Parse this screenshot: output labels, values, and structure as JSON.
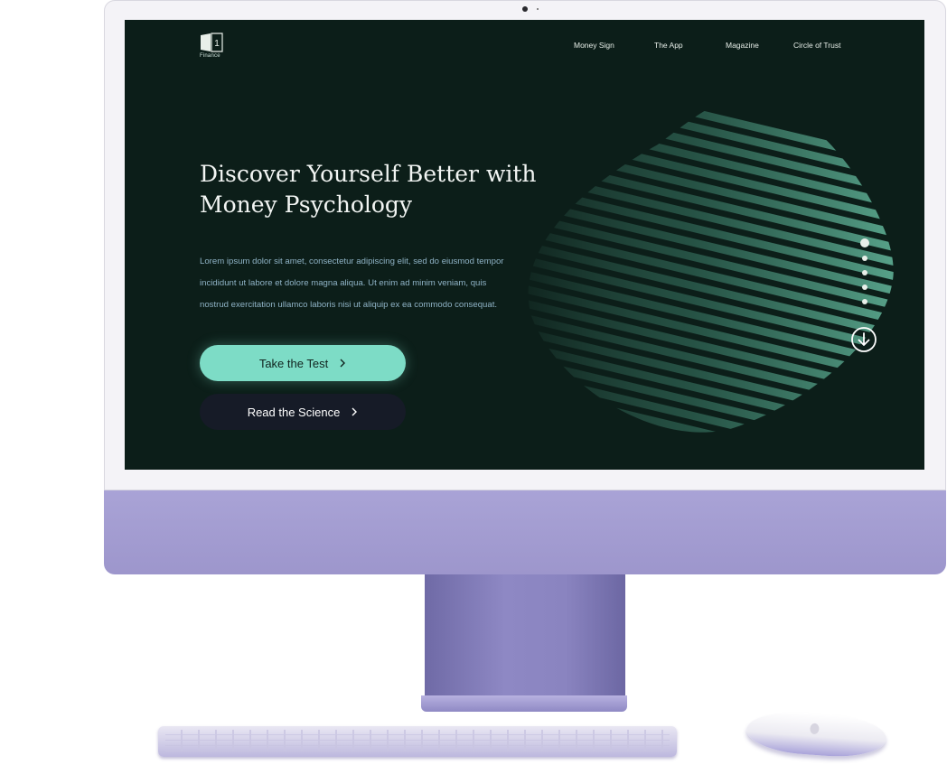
{
  "brand": {
    "name": "Finance",
    "logo_number": "1"
  },
  "nav": {
    "items": [
      {
        "label": "Money Sign"
      },
      {
        "label": "The App"
      },
      {
        "label": "Magazine"
      },
      {
        "label": "Circle of Trust"
      }
    ]
  },
  "hero": {
    "headline_lines": [
      "Discover Yourself  Better with",
      "Money Psychology"
    ],
    "body_lines": [
      "Lorem ipsum dolor sit amet, consectetur adipiscing elit, sed do eiusmod tempor",
      "incididunt ut labore et dolore magna aliqua. Ut enim ad minim veniam, quis",
      "nostrud exercitation ullamco laboris nisi ut aliquip ex ea commodo consequat."
    ],
    "primary_button": {
      "label": "Take the Test",
      "icon": "chevron-right-icon"
    },
    "secondary_button": {
      "label": "Read the Science",
      "icon": "chevron-right-icon"
    }
  },
  "pager": {
    "total": 5,
    "active_index": 0
  },
  "scroll_down": {
    "icon": "arrow-down-circle-icon"
  },
  "colors": {
    "screen_bg": "#0c1e19",
    "accent": "#7ddcc6",
    "stripe": "#4f9a82",
    "body_text": "#8fb3c6",
    "device_purple": "#a19bd0"
  }
}
